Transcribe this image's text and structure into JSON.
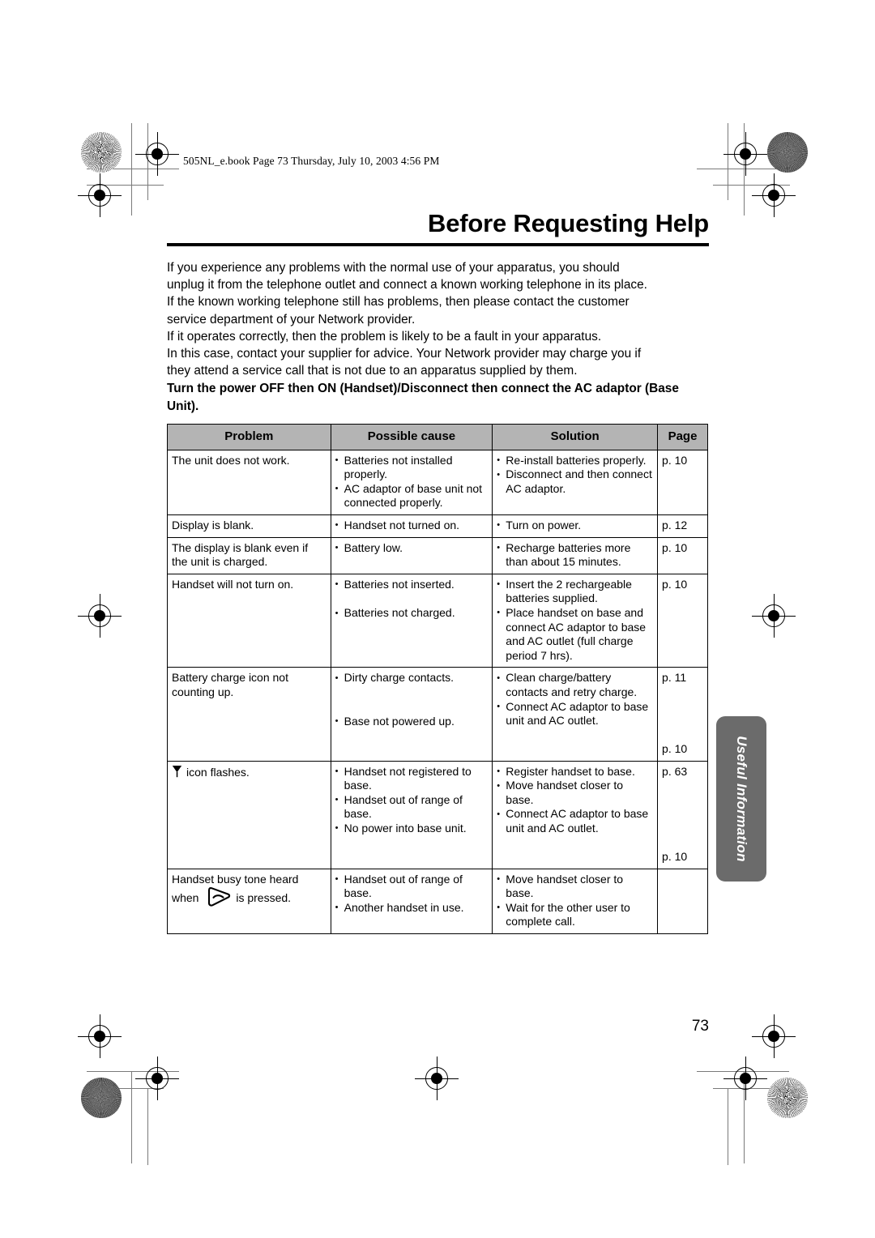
{
  "print_marks": {
    "note": "offset printing registration marks and crop lines"
  },
  "header": {
    "file_stamp": "505NL_e.book  Page 73  Thursday, July 10, 2003  4:56 PM"
  },
  "chapter": {
    "title": "Before Requesting Help"
  },
  "intro": {
    "paragraphs": [
      "If you experience any problems with the normal use of your apparatus, you should",
      "unplug it from the telephone outlet and connect a known working telephone in its place.",
      "If the known working telephone still has problems, then please contact the customer",
      "service department of your Network provider.",
      "If it operates correctly, then the problem is likely to be a fault in your apparatus.",
      "In this case, contact your supplier for advice. Your Network provider may charge you if",
      "they attend a service call that is not due to an apparatus supplied by them."
    ],
    "bold_note": "Turn the power OFF then ON (Handset)/Disconnect then connect the AC adaptor (Base Unit)."
  },
  "table": {
    "headers": {
      "problem": "Problem",
      "cause": "Possible cause",
      "solution": "Solution",
      "page": "Page"
    },
    "rows": [
      {
        "problem": "The unit does not work.",
        "causes": [
          "Batteries not installed properly.",
          "AC adaptor of base unit not connected properly."
        ],
        "solutions": [
          "Re-install batteries properly.",
          "Disconnect and then connect AC adaptor."
        ],
        "pages": [
          "p. 10"
        ]
      },
      {
        "problem": "Display is blank.",
        "causes": [
          "Handset not turned on."
        ],
        "solutions": [
          "Turn on power."
        ],
        "pages": [
          "p. 12"
        ]
      },
      {
        "problem": "The display is blank even if the unit is charged.",
        "causes": [
          "Battery low."
        ],
        "solutions": [
          "Recharge batteries more than about 15 minutes."
        ],
        "pages": [
          "p. 10"
        ]
      },
      {
        "problem": "Handset will not turn on.",
        "causes": [
          "Batteries not inserted.",
          "Batteries not charged."
        ],
        "solutions": [
          "Insert the 2 rechargeable batteries supplied.",
          "Place handset on base and connect AC adaptor to base and AC outlet (full charge period 7 hrs)."
        ],
        "pages": [
          "p. 10"
        ]
      },
      {
        "problem": "Battery charge icon not counting up.",
        "causes": [
          "Dirty charge contacts.",
          "Base not powered up."
        ],
        "solutions": [
          "Clean charge/battery contacts and retry charge.",
          "Connect AC adaptor to base unit and AC outlet."
        ],
        "pages": [
          "p. 11",
          "p. 10"
        ]
      },
      {
        "problem_icon": "antenna-icon",
        "problem": "icon flashes.",
        "causes": [
          "Handset not registered to base.",
          "Handset out of range of base.",
          "No power into base unit."
        ],
        "solutions": [
          "Register handset to base.",
          "Move handset closer to base.",
          "Connect AC adaptor to base unit and AC outlet."
        ],
        "pages": [
          "p. 63",
          "p. 10"
        ]
      },
      {
        "problem_prefix": "Handset busy tone heard when",
        "problem_icon": "talk-handset-icon",
        "problem_suffix": "is pressed.",
        "causes": [
          "Handset out of range of base.",
          "Another handset in use."
        ],
        "solutions": [
          "Move handset closer to base.",
          "Wait for the other user to complete call."
        ],
        "pages": [
          ""
        ]
      }
    ]
  },
  "side_tab": {
    "label": "Useful Information"
  },
  "footer": {
    "page_number": "73"
  },
  "colors": {
    "header_gray": "#b4b4b4",
    "tab_gray": "#6b6b6b",
    "text": "#000000"
  }
}
